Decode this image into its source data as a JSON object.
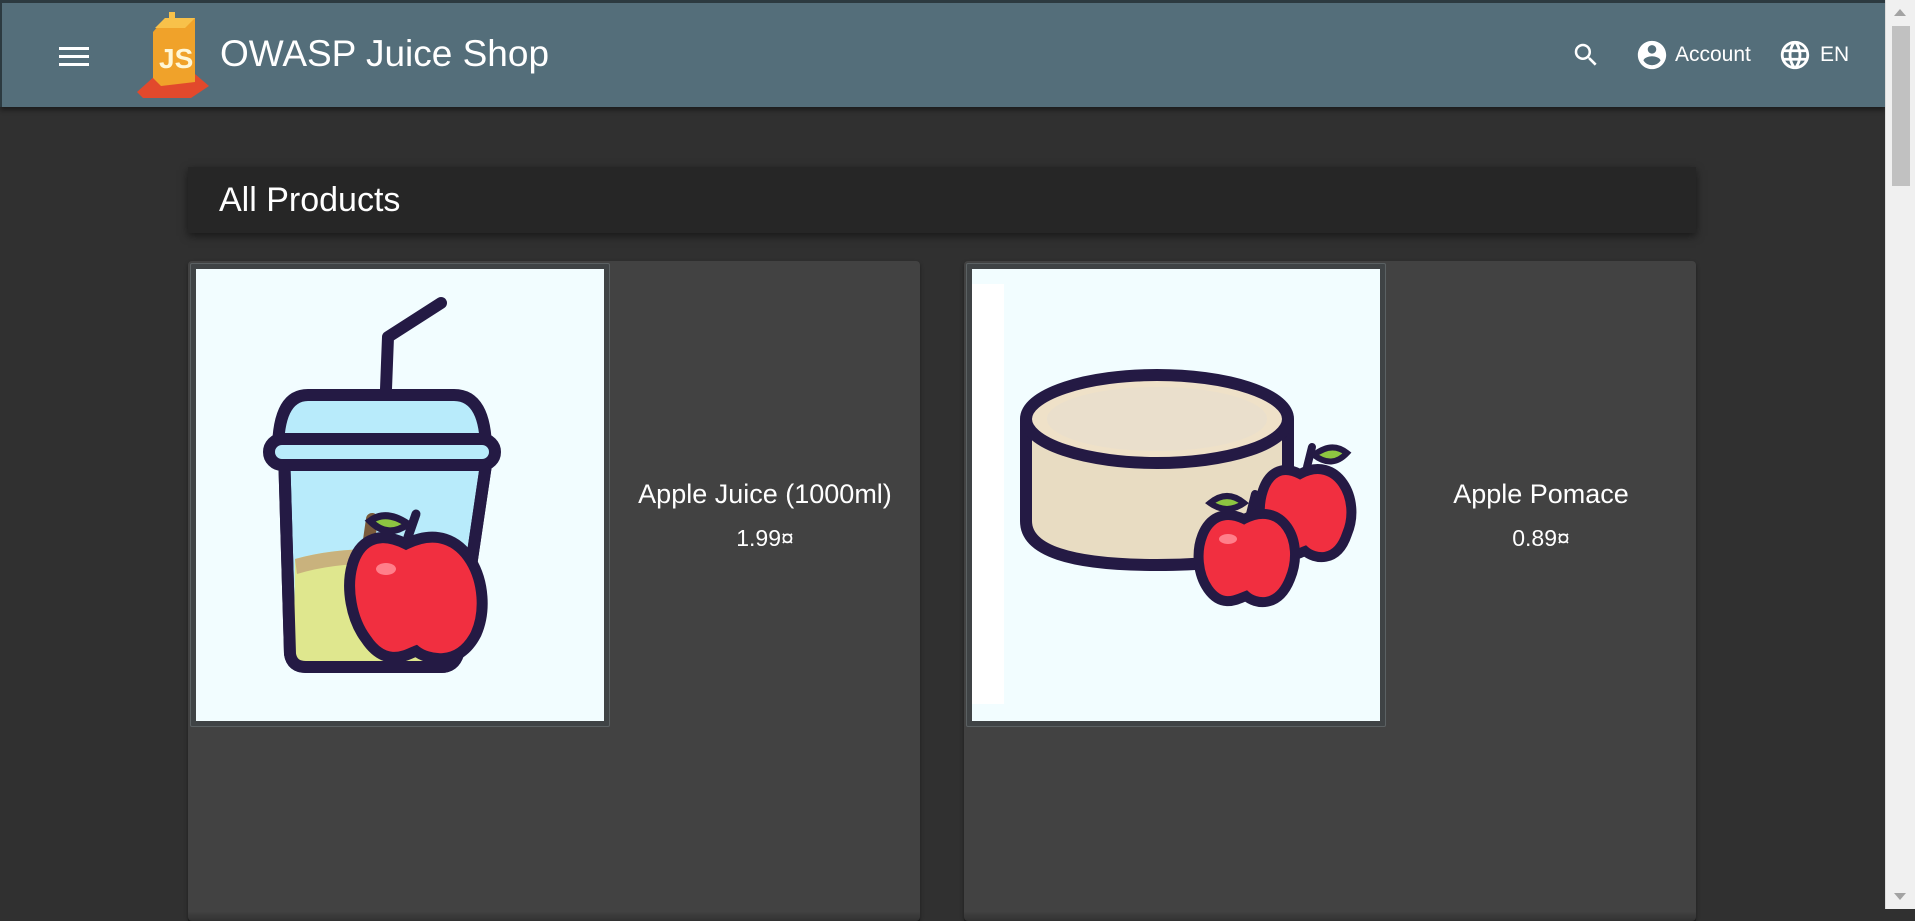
{
  "header": {
    "title": "OWASP Juice Shop",
    "logo_text": "JS",
    "account_label": "Account",
    "language_label": "EN"
  },
  "page": {
    "heading": "All Products"
  },
  "products": [
    {
      "name": "Apple Juice (1000ml)",
      "price": "1.99¤",
      "icon": "apple-juice-cup-image"
    },
    {
      "name": "Apple Pomace",
      "price": "0.89¤",
      "icon": "apple-pomace-image"
    }
  ],
  "colors": {
    "toolbar": "#546e7a",
    "background": "#303030",
    "card": "#424242",
    "heading_card": "#262626",
    "apple_red": "#f12f40",
    "outline": "#231a44"
  }
}
